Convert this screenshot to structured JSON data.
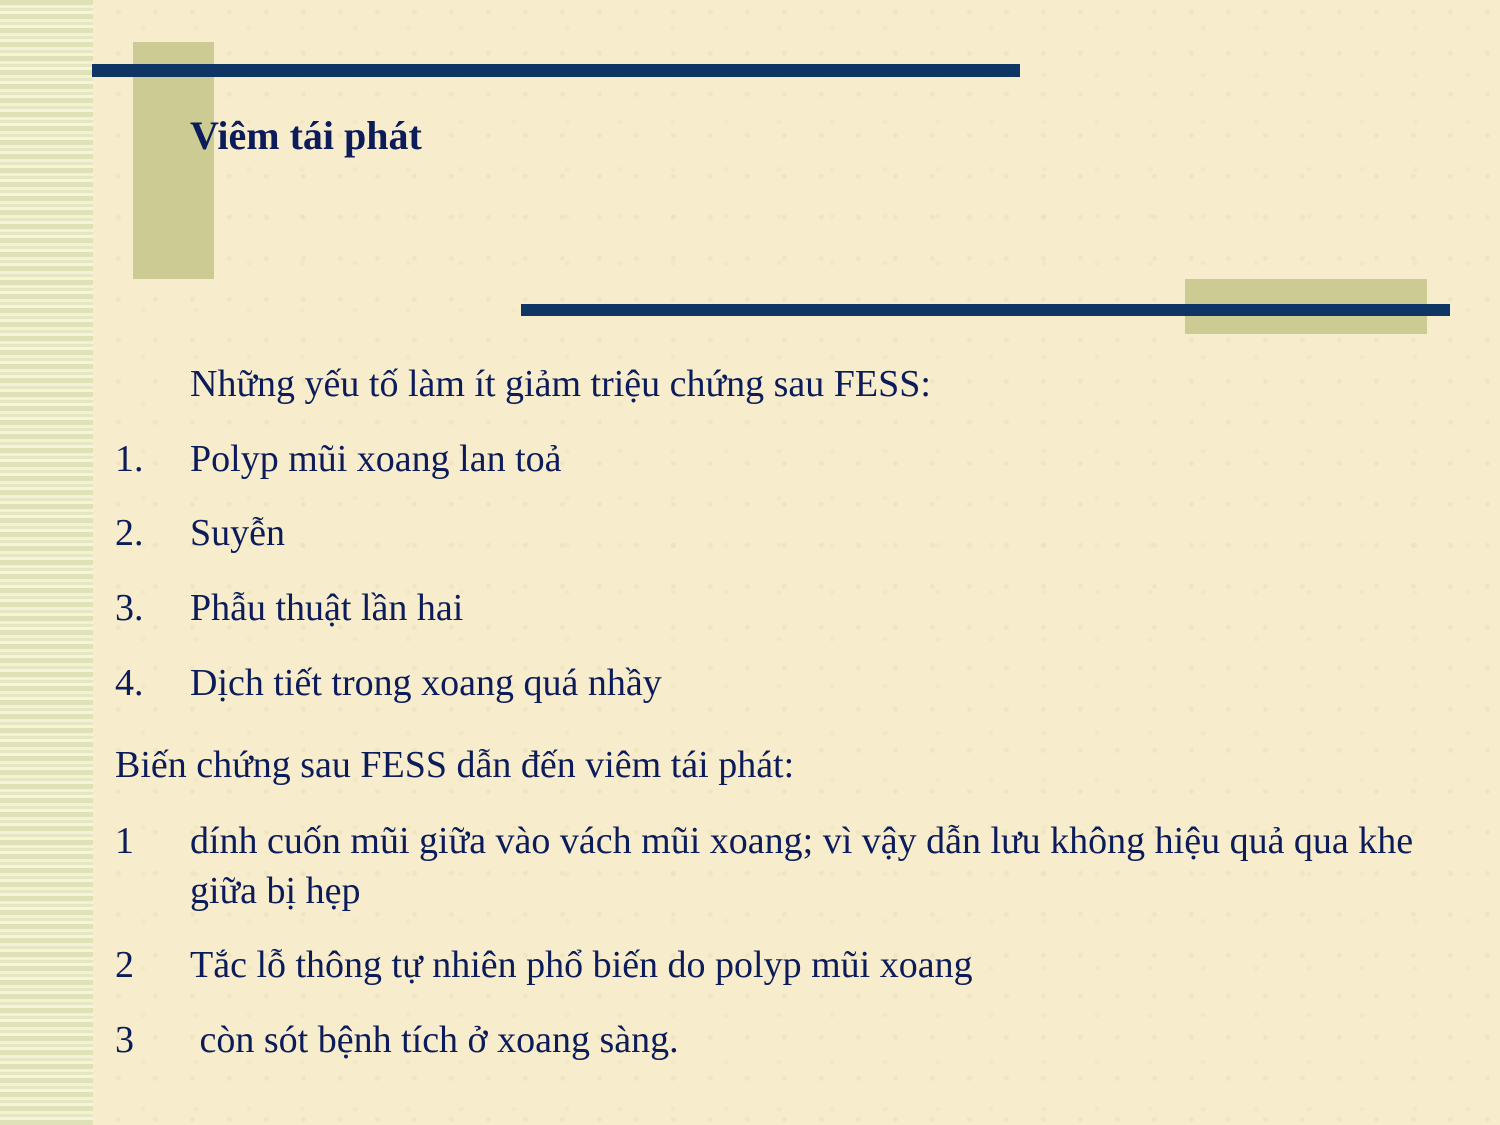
{
  "slide": {
    "title": "Viêm tái phát",
    "intro": "Những yếu tố làm ít giảm triệu chứng sau FESS:",
    "factors": [
      {
        "num": "1.",
        "text": "Polyp mũi xoang lan toả"
      },
      {
        "num": "2.",
        "text": "Suyễn"
      },
      {
        "num": "3.",
        "text": "Phẫu thuật lần hai"
      },
      {
        "num": "4.",
        "text": "Dịch tiết trong xoang quá nhầy"
      }
    ],
    "complications_heading": "Biến chứng sau FESS dẫn đến viêm tái phát:",
    "complications": [
      {
        "num": "1",
        "text": "dính cuốn mũi giữa vào vách mũi xoang; vì vậy dẫn lưu không hiệu quả qua khe giữa bị hẹp"
      },
      {
        "num": "2",
        "text": "Tắc lỗ thông tự nhiên phổ biến do polyp mũi xoang"
      },
      {
        "num": "3",
        "text": " còn sót bệnh tích ở xoang sàng."
      }
    ]
  },
  "colors": {
    "background": "#f7edcc",
    "navy": "#0e3563",
    "olive": "#cbcb93",
    "text": "#0c1c5a"
  }
}
